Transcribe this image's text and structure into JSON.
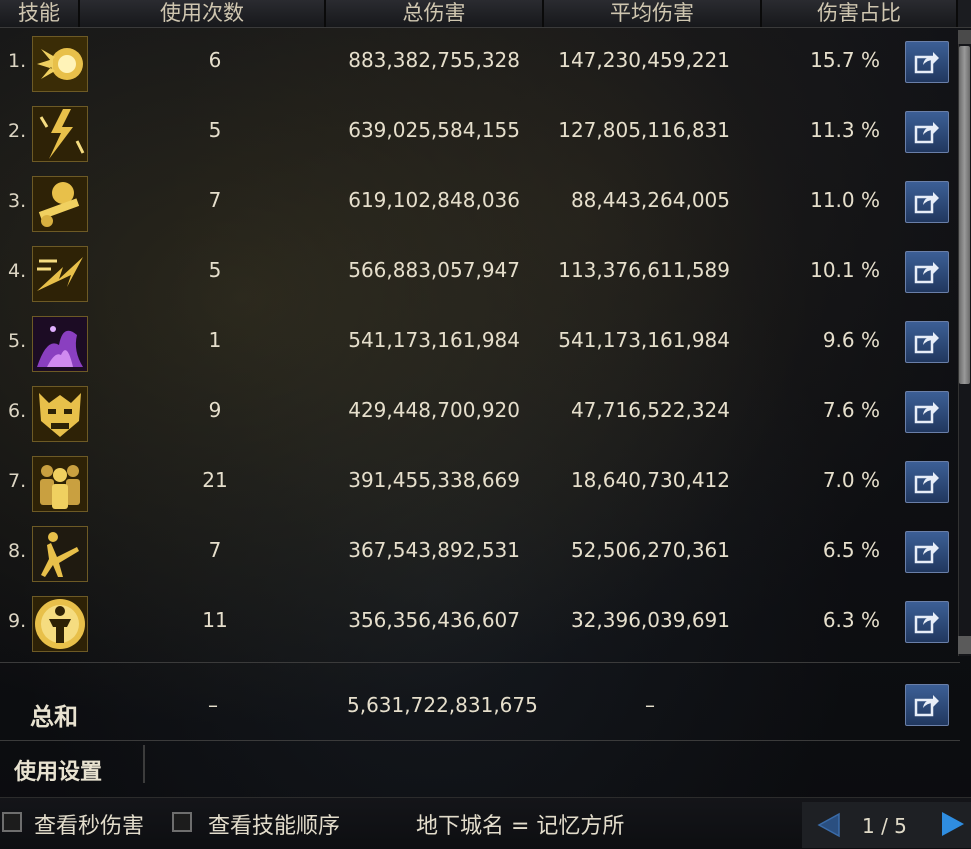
{
  "header": {
    "skill": "技能",
    "uses": "使用次数",
    "total": "总伤害",
    "avg": "平均伤害",
    "pct": "伤害占比"
  },
  "rows": [
    {
      "index": "1.",
      "icon": "burst-icon",
      "uses": "6",
      "total": "883,382,755,328",
      "avg": "147,230,459,221",
      "pct": "15.7 %"
    },
    {
      "index": "2.",
      "icon": "lightning-strike-icon",
      "uses": "5",
      "total": "639,025,584,155",
      "avg": "127,805,116,831",
      "pct": "11.3 %"
    },
    {
      "index": "3.",
      "icon": "cannon-shot-icon",
      "uses": "7",
      "total": "619,102,848,036",
      "avg": "88,443,264,005",
      "pct": "11.0 %"
    },
    {
      "index": "4.",
      "icon": "dash-strike-icon",
      "uses": "5",
      "total": "566,883,057,947",
      "avg": "113,376,611,589",
      "pct": "10.1 %"
    },
    {
      "index": "5.",
      "icon": "purple-flame-icon",
      "uses": "1",
      "total": "541,173,161,984",
      "avg": "541,173,161,984",
      "pct": "9.6 %"
    },
    {
      "index": "6.",
      "icon": "demon-mask-icon",
      "uses": "9",
      "total": "429,448,700,920",
      "avg": "47,716,522,324",
      "pct": "7.6 %"
    },
    {
      "index": "7.",
      "icon": "clone-figures-icon",
      "uses": "21",
      "total": "391,455,338,669",
      "avg": "18,640,730,412",
      "pct": "7.0 %"
    },
    {
      "index": "8.",
      "icon": "kick-icon",
      "uses": "7",
      "total": "367,543,892,531",
      "avg": "52,506,270,361",
      "pct": "6.5 %"
    },
    {
      "index": "9.",
      "icon": "power-aura-icon",
      "uses": "11",
      "total": "356,356,436,607",
      "avg": "32,396,039,691",
      "pct": "6.3 %"
    }
  ],
  "summary": {
    "label": "总和",
    "uses": "–",
    "total": "5,631,722,831,675",
    "avg": "–"
  },
  "settings_label": "使用设置",
  "footer": {
    "per_second_label": "查看秒伤害",
    "skill_order_label": "查看技能顺序",
    "dungeon_text": "地下城名 = 记忆方所",
    "page": "1 / 5"
  },
  "colors": {
    "icon_gold": "#e8c04a",
    "button_blue": "#2d4a7a",
    "arrow_blue": "#2f8de0",
    "text": "#e6dfcc"
  }
}
